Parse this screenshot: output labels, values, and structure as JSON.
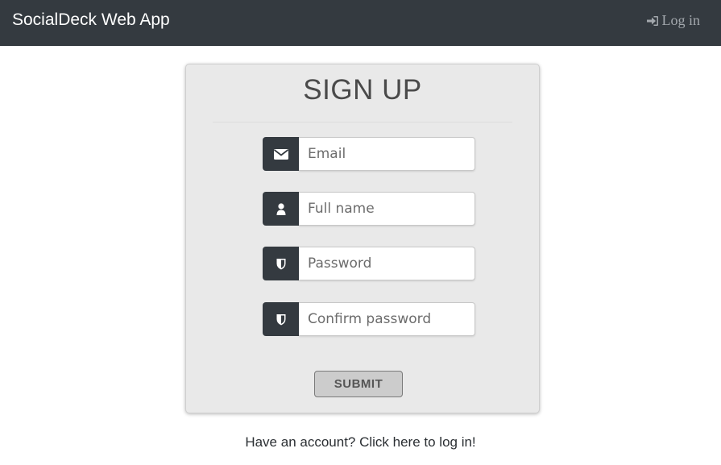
{
  "navbar": {
    "brand": "SocialDeck Web App",
    "login_label": "Log in",
    "login_icon": "sign-in-icon"
  },
  "form": {
    "title": "SIGN UP",
    "fields": [
      {
        "placeholder": "Email",
        "value": "",
        "icon": "envelope-icon"
      },
      {
        "placeholder": "Full name",
        "value": "",
        "icon": "user-icon"
      },
      {
        "placeholder": "Password",
        "value": "",
        "icon": "shield-icon"
      },
      {
        "placeholder": "Confirm password",
        "value": "",
        "icon": "shield-icon"
      }
    ],
    "submit_label": "SUBMIT"
  },
  "footer": {
    "login_prompt": "Have an account? Click here to log in!"
  },
  "colors": {
    "navbar_bg": "#343a40",
    "card_bg": "#e9e9e9",
    "addon_bg": "#343a40",
    "submit_bg": "#cccccc"
  }
}
